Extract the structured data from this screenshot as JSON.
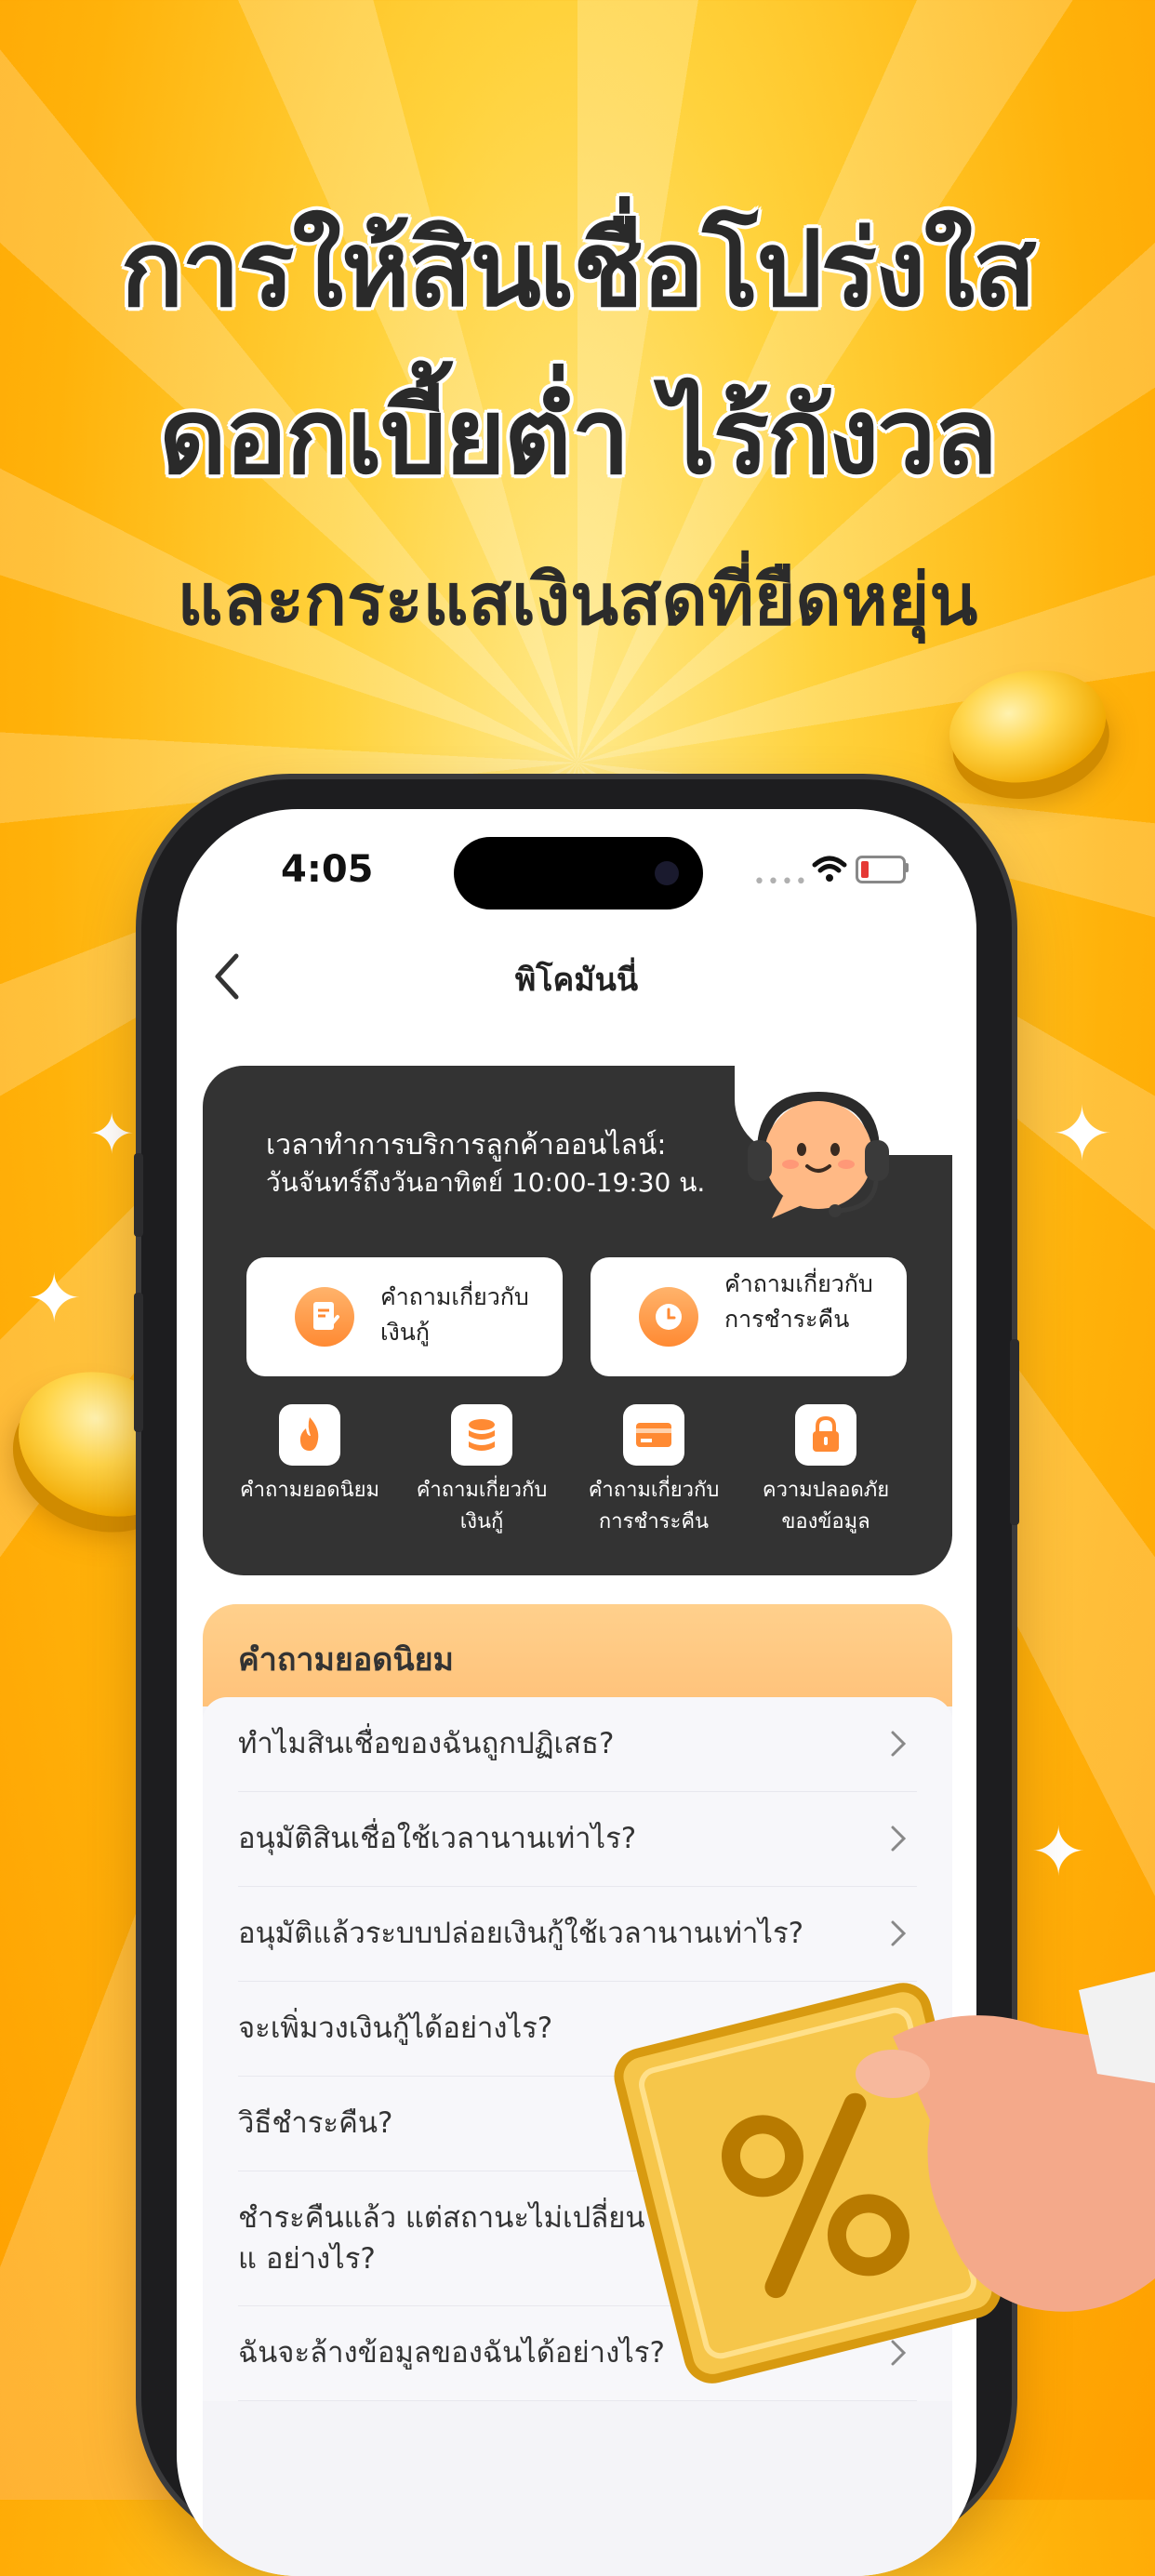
{
  "hero": {
    "line1": "การให้สินเชื่อโปร่งใส",
    "line2": "ดอกเบี้ยต่ำ ไร้กังวล",
    "line3": "และกระแสเงินสดที่ยืดหยุ่น"
  },
  "status_bar": {
    "time": "4:05"
  },
  "nav": {
    "title": "พิโคมันนี่"
  },
  "service": {
    "line1": "เวลาทำการบริการลูกค้าออนไลน์:",
    "line2": "วันจันทร์ถึงวันอาทิตย์ 10:00-19:30 น."
  },
  "quick_buttons": [
    {
      "label": "คำถามเกี่ยวกับเงินกู้",
      "icon": "document-edit-icon"
    },
    {
      "label": "คำถามเกี่ยวกับการชำระคืน",
      "icon": "clock-icon"
    }
  ],
  "categories": [
    {
      "label": "คำถามยอดนิยม",
      "icon": "fire-icon"
    },
    {
      "label": "คำถามเกี่ยวกับเงินกู้",
      "icon": "coin-stack-icon"
    },
    {
      "label": "คำถามเกี่ยวกับการชำระคืน",
      "icon": "credit-card-icon"
    },
    {
      "label": "ความปลอดภัยของข้อมูล",
      "icon": "lock-icon"
    }
  ],
  "faq": {
    "title": "คำถามยอดนิยม",
    "items": [
      "ทำไมสินเชื่อของฉันถูกปฏิเสธ?",
      "อนุมัติสินเชื่อใช้เวลานานเท่าไร?",
      "อนุมัติแล้วระบบปล่อยเงินกู้ใช้เวลานานเท่าไร?",
      "จะเพิ่มวงเงินกู้ได้อย่างไร?",
      "วิธีชำระคืน?",
      "ชำระคืนแล้ว แต่สถานะไม่เปลี่ยนแ อย่างไร?",
      "ฉันจะล้างข้อมูลของฉันได้อย่างไร?"
    ]
  },
  "colors": {
    "accent_orange": "#ff8a33",
    "dark_card": "#333333",
    "faq_header": "#ffc27a",
    "background_yellow": "#ffc21a"
  }
}
